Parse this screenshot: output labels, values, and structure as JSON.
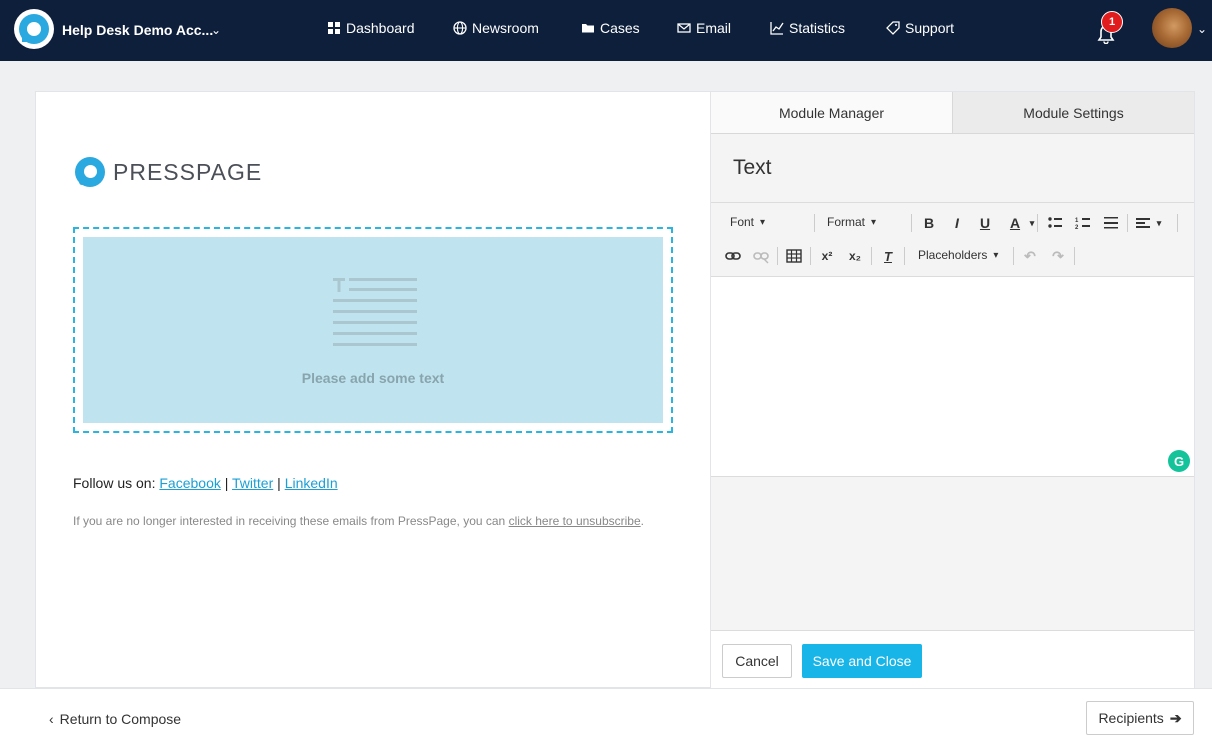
{
  "topnav": {
    "account_name": "Help Desk Demo Acc...",
    "items": [
      {
        "label": "Dashboard",
        "icon": "grid-icon"
      },
      {
        "label": "Newsroom",
        "icon": "globe-icon"
      },
      {
        "label": "Cases",
        "icon": "folder-icon"
      },
      {
        "label": "Email",
        "icon": "envelope-icon"
      },
      {
        "label": "Statistics",
        "icon": "chart-icon"
      },
      {
        "label": "Support",
        "icon": "tag-icon"
      }
    ],
    "notification_count": "1",
    "bg_color": "#0e1f3b"
  },
  "email": {
    "logo_text": "PRESSPAGE",
    "text_placeholder": "Please add some text",
    "follow_label": "Follow us on:",
    "follow_links": [
      "Facebook",
      "Twitter",
      "LinkedIn"
    ],
    "separator": "|",
    "unsubscribe_text": "If you are no longer interested in receiving these emails from PressPage, you can",
    "unsubscribe_link": "click here to unsubscribe",
    "unsubscribe_end": "."
  },
  "panel": {
    "tabs": [
      "Module Manager",
      "Module Settings"
    ],
    "title": "Text",
    "toolbar": {
      "font": "Font",
      "format": "Format",
      "placeholders": "Placeholders"
    },
    "cancel": "Cancel",
    "save": "Save and Close",
    "accent_color": "#17b5e8"
  },
  "bottom": {
    "return_label": "Return to Compose",
    "recipients_label": "Recipients"
  }
}
